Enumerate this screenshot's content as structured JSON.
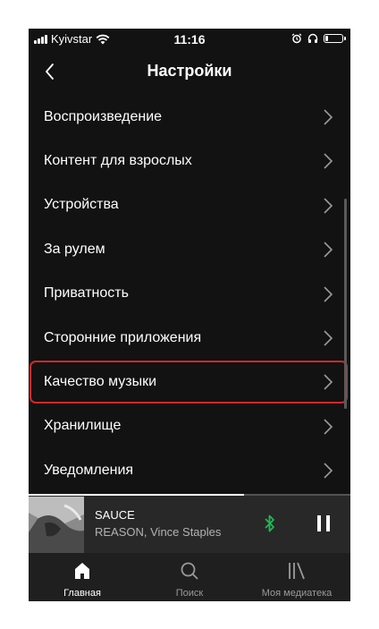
{
  "status_bar": {
    "carrier": "Kyivstar",
    "time": "11:16",
    "battery_level": 0.25
  },
  "header": {
    "title": "Настройки",
    "back_icon": "chevron-left-icon"
  },
  "settings": {
    "items": [
      {
        "label": "Воспроизведение"
      },
      {
        "label": "Контент для взрослых"
      },
      {
        "label": "Устройства"
      },
      {
        "label": "За рулем"
      },
      {
        "label": "Приватность"
      },
      {
        "label": "Сторонние приложения"
      },
      {
        "label": "Качество музыки",
        "highlighted": true
      },
      {
        "label": "Хранилище"
      },
      {
        "label": "Уведомления"
      }
    ]
  },
  "player": {
    "title": "SAUCE",
    "artist": "REASON, Vince Staples",
    "progress": 0.67,
    "bluetooth_color": "#1db954"
  },
  "tabs": [
    {
      "label": "Главная",
      "icon": "home-icon",
      "active": true
    },
    {
      "label": "Поиск",
      "icon": "search-icon",
      "active": false
    },
    {
      "label": "Моя медиатека",
      "icon": "library-icon",
      "active": false
    }
  ],
  "colors": {
    "background": "#121212",
    "highlight_border": "#d4262b",
    "accent_green": "#1db954"
  }
}
